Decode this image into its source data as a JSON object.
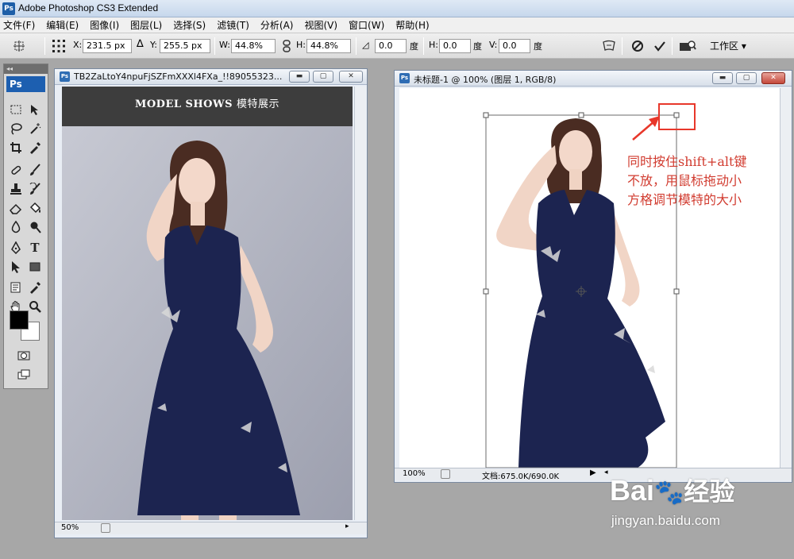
{
  "app": {
    "title": "Adobe Photoshop CS3 Extended",
    "logo": "Ps"
  },
  "menu": [
    "文件(F)",
    "编辑(E)",
    "图像(I)",
    "图层(L)",
    "选择(S)",
    "滤镜(T)",
    "分析(A)",
    "视图(V)",
    "窗口(W)",
    "帮助(H)"
  ],
  "options": {
    "x_label": "X:",
    "x_value": "231.5 px",
    "y_label": "Y:",
    "y_value": "255.5 px",
    "w_label": "W:",
    "w_value": "44.8%",
    "h_label": "H:",
    "h_value": "44.8%",
    "rotate_value": "0.0",
    "rotate_unit": "度",
    "hskew_label": "H:",
    "hskew_value": "0.0",
    "hskew_unit": "度",
    "vskew_label": "V:",
    "vskew_value": "0.0",
    "vskew_unit": "度",
    "workspace_label": "工作区 ▾"
  },
  "tools_panel": {
    "badge": "Ps",
    "collapse": "◂◂"
  },
  "left_doc": {
    "title": "TB2ZaLtoY4npuFjSZFmXXXl4FXa_!!89055323...",
    "banner_en": "MODEL SHOWS",
    "banner_cn": "模特展示",
    "zoom": "50%"
  },
  "right_doc": {
    "title": "未标题-1 @ 100% (图层 1, RGB/8)",
    "zoom": "100%",
    "doc_size": "文档:675.0K/690.0K"
  },
  "annotation": {
    "lines": [
      "同时按住shift+alt键",
      "不放，用鼠标拖动小",
      "方格调节模特的大小"
    ],
    "color": "#d13b2f"
  },
  "watermark": {
    "brand": "Bai",
    "cn": "经验",
    "url": "jingyan.baidu.com"
  },
  "colors": {
    "foreground": "#000000",
    "background": "#ffffff",
    "dress": "#1c2450"
  }
}
